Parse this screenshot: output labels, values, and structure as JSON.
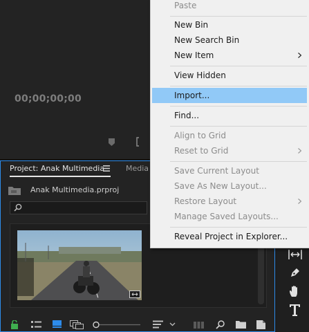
{
  "monitor": {
    "timecode": "00;00;00;00"
  },
  "project_panel": {
    "tab_project": "Project: Anak Multimedia",
    "tab_media": "Media",
    "file_name": "Anak Multimedia.prproj",
    "search_placeholder": ""
  },
  "context_menu": {
    "items": [
      {
        "label": "Paste",
        "enabled": false
      },
      {
        "label": "New Bin",
        "enabled": true
      },
      {
        "label": "New Search Bin",
        "enabled": true
      },
      {
        "label": "New Item",
        "enabled": true,
        "submenu": true
      },
      {
        "label": "View Hidden",
        "enabled": true
      },
      {
        "label": "Import...",
        "enabled": true,
        "highlighted": true
      },
      {
        "label": "Find...",
        "enabled": true
      },
      {
        "label": "Align to Grid",
        "enabled": false
      },
      {
        "label": "Reset to Grid",
        "enabled": false,
        "submenu": true
      },
      {
        "label": "Save Current Layout",
        "enabled": false
      },
      {
        "label": "Save As New Layout...",
        "enabled": false
      },
      {
        "label": "Restore Layout",
        "enabled": false,
        "submenu": true
      },
      {
        "label": "Manage Saved Layouts...",
        "enabled": false
      },
      {
        "label": "Reveal Project in Explorer...",
        "enabled": true
      }
    ]
  },
  "colors": {
    "accent": "#2d8ceb",
    "menu_highlight": "#91c9f7",
    "lock_green": "#3fae4f"
  },
  "icons": {
    "toolbar": [
      "lock-icon",
      "list-view-icon",
      "icon-view-icon",
      "freeform-view-icon",
      "zoom-slider",
      "sort-icon",
      "chevron-down-icon",
      "automate-icon",
      "find-icon",
      "new-bin-icon",
      "new-item-icon"
    ],
    "tools": [
      "ripple-edit-icon",
      "pen-icon",
      "hand-icon",
      "type-icon"
    ]
  }
}
